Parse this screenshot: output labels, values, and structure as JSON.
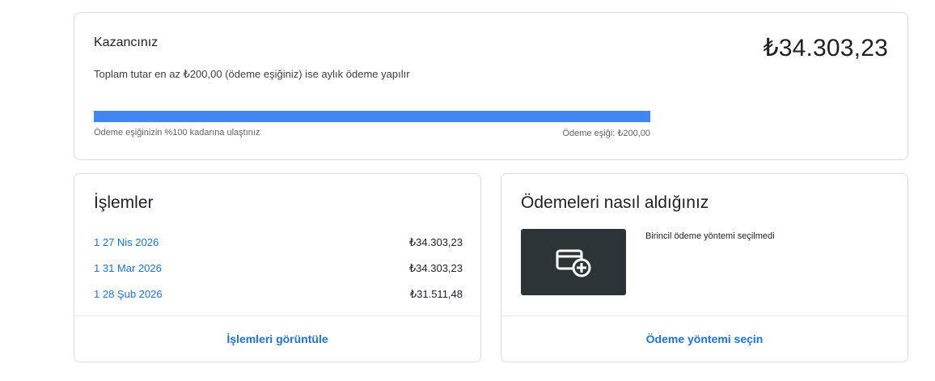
{
  "earnings": {
    "title": "Kazancınız",
    "subtitle": "Toplam tutar en az ₺200,00 (ödeme eşiğiniz) ise aylık ödeme yapılır",
    "amount": "₺34.303,23",
    "progress_percent": 100,
    "progress_left_label": "Ödeme eşiğinizin %100 kadarına ulaştınız",
    "progress_right_label": "Ödeme eşiği: ₺200,00",
    "accent_color": "#4285f4"
  },
  "transactions": {
    "title": "İşlemler",
    "rows": [
      {
        "date": "1  27 Nis 2026",
        "amount": "₺34.303,23"
      },
      {
        "date": "1  31 Mar 2026",
        "amount": "₺34.303,23"
      },
      {
        "date": "1  28 Şub 2026",
        "amount": "₺31.511,48"
      }
    ],
    "link_label": "İşlemleri görüntüle"
  },
  "payments": {
    "title": "Ödemeleri nasıl aldığınız",
    "status_text": "Birincil ödeme yöntemi seçilmedi",
    "icon": "add-card-icon",
    "link_label": "Ödeme yöntemi seçin"
  }
}
